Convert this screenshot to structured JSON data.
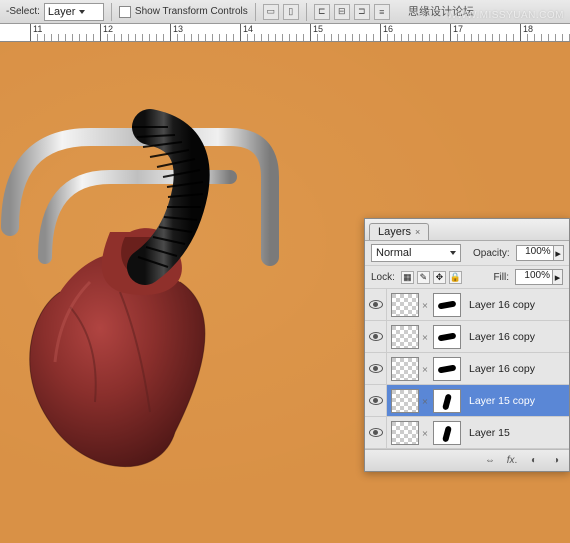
{
  "options_bar": {
    "select_label": "-Select:",
    "select_value": "Layer",
    "show_transform_label": "Show Transform Controls",
    "overlay_text": "思缘设计论坛"
  },
  "watermark": "WWW.MISSYUAN.COM",
  "ruler": {
    "majors": [
      {
        "pos": 30,
        "label": "11"
      },
      {
        "pos": 100,
        "label": "12"
      },
      {
        "pos": 170,
        "label": "13"
      },
      {
        "pos": 240,
        "label": "14"
      },
      {
        "pos": 310,
        "label": "15"
      },
      {
        "pos": 380,
        "label": "16"
      },
      {
        "pos": 450,
        "label": "17"
      },
      {
        "pos": 520,
        "label": "18"
      }
    ]
  },
  "layers_panel": {
    "tab_label": "Layers",
    "blend_mode": "Normal",
    "opacity_label": "Opacity:",
    "opacity_value": "100%",
    "lock_label": "Lock:",
    "fill_label": "Fill:",
    "fill_value": "100%",
    "layers": [
      {
        "name": "Layer 16 copy",
        "selected": false,
        "mask": "mask-shape1"
      },
      {
        "name": "Layer 16 copy",
        "selected": false,
        "mask": "mask-shape1"
      },
      {
        "name": "Layer 16 copy",
        "selected": false,
        "mask": "mask-shape1"
      },
      {
        "name": "Layer 15 copy",
        "selected": true,
        "mask": "mask-shape2"
      },
      {
        "name": "Layer 15",
        "selected": false,
        "mask": "mask-shape2"
      }
    ]
  }
}
